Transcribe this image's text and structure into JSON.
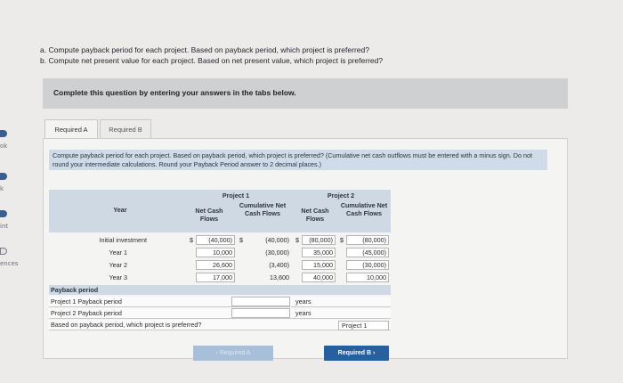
{
  "rail": {
    "items": [
      "ok",
      "k",
      "int",
      "ences"
    ]
  },
  "question": {
    "line_a": "a. Compute payback period for each project. Based on payback period, which project is preferred?",
    "line_b": "b. Compute net present value for each project. Based on net present value, which project is preferred?"
  },
  "banner": {
    "text": "Complete this question by entering your answers in the tabs below."
  },
  "tabs": [
    {
      "label": "Required A"
    },
    {
      "label": "Required B"
    }
  ],
  "instruction": "Compute payback period for each project. Based on payback period, which project is preferred? (Cumulative net cash outflows must be entered with a minus sign. Do not round your intermediate calculations. Round your Payback Period answer to 2 decimal places.)",
  "table": {
    "year_header": "Year",
    "project1": "Project 1",
    "project2": "Project 2",
    "net_cash_flows": "Net Cash Flows",
    "cumulative": "Cumulative Net Cash Flows",
    "rows": [
      {
        "label": "Initial investment",
        "p1_net": "(40,000)",
        "p1_cum": "(40,000)",
        "p2_net": "(80,000)",
        "p2_cum": "(80,000)"
      },
      {
        "label": "Year 1",
        "p1_net": "10,000",
        "p1_cum": "(30,000)",
        "p2_net": "35,000",
        "p2_cum": "(45,000)"
      },
      {
        "label": "Year 2",
        "p1_net": "26,600",
        "p1_cum": "(3,400)",
        "p2_net": "15,000",
        "p2_cum": "(30,000)"
      },
      {
        "label": "Year 3",
        "p1_net": "17,000",
        "p1_cum": "13,600",
        "p2_net": "40,000",
        "p2_cum": "10,000"
      }
    ],
    "dollar": "$",
    "payback_header": "Payback period",
    "p1_payback_label": "Project 1 Payback period",
    "p2_payback_label": "Project 2 Payback period",
    "preferred_label": "Based on payback period, which project is preferred?",
    "years_unit": "years",
    "preferred_value": "Project 1"
  },
  "nav": {
    "prev": "Required A",
    "next": "Required B"
  }
}
